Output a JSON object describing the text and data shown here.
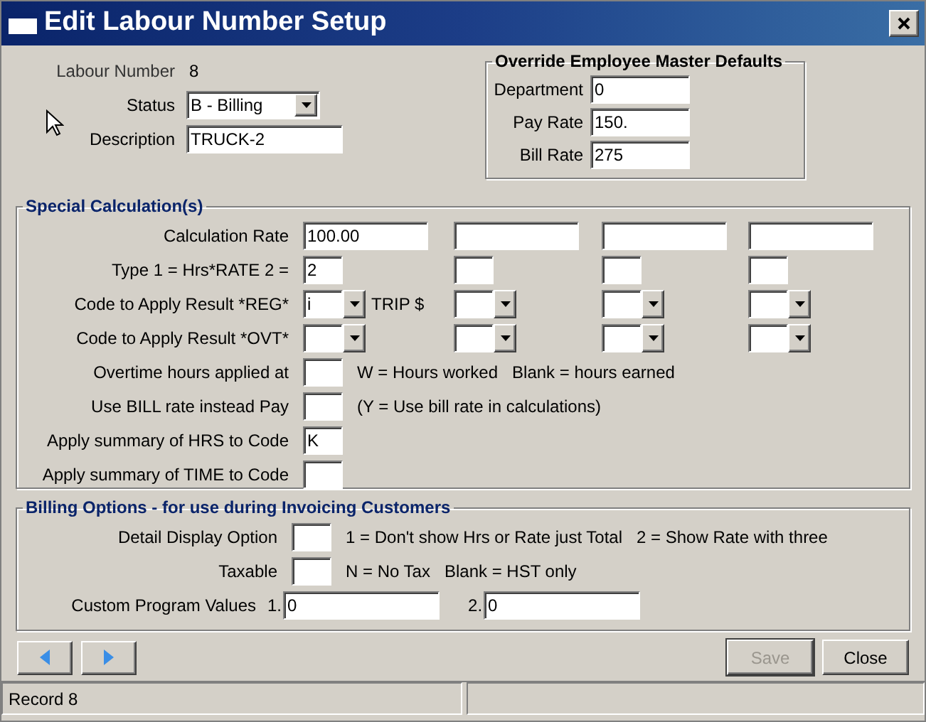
{
  "window": {
    "title": "Edit Labour Number Setup"
  },
  "header": {
    "labour_number": {
      "label": "Labour Number",
      "value": "8"
    },
    "status": {
      "label": "Status",
      "value": "B - Billing"
    },
    "description": {
      "label": "Description",
      "value": "TRUCK-2"
    }
  },
  "override": {
    "title": "Override Employee Master Defaults",
    "fields": [
      {
        "label": "Department",
        "value": "0"
      },
      {
        "label": "Pay Rate",
        "value": "150."
      },
      {
        "label": "Bill Rate",
        "value": "275"
      }
    ]
  },
  "special": {
    "title": "Special Calculation(s)",
    "rows": [
      {
        "label": "Calculation Rate",
        "cells": [
          {
            "kind": "wide",
            "value": "100.00"
          },
          {
            "kind": "wide"
          },
          {
            "kind": "wide"
          },
          {
            "kind": "wide"
          }
        ]
      },
      {
        "label": "Type 1 = Hrs*RATE  2 =",
        "cells": [
          {
            "kind": "narrow",
            "value": "2"
          },
          {
            "kind": "narrow"
          },
          {
            "kind": "narrow"
          },
          {
            "kind": "narrow"
          }
        ]
      },
      {
        "label": "Code to Apply Result *REG*",
        "cells": [
          {
            "kind": "combo",
            "value": "i",
            "note": "TRIP $"
          },
          {
            "kind": "combo"
          },
          {
            "kind": "combo"
          },
          {
            "kind": "combo"
          }
        ]
      },
      {
        "label": "Code to Apply Result *OVT*",
        "cells": [
          {
            "kind": "combo"
          },
          {
            "kind": "combo"
          },
          {
            "kind": "combo"
          },
          {
            "kind": "combo"
          }
        ]
      },
      {
        "label": "Overtime hours applied at",
        "cells": [
          {
            "kind": "narrow"
          }
        ],
        "notes": [
          "W = Hours worked",
          "Blank = hours earned"
        ]
      },
      {
        "label": "Use BILL rate instead Pay",
        "cells": [
          {
            "kind": "narrow"
          }
        ],
        "notes": [
          "(Y = Use bill rate in calculations)"
        ]
      },
      {
        "label": "Apply summary of HRS to Code",
        "cells": [
          {
            "kind": "narrow",
            "value": "K"
          }
        ]
      },
      {
        "label": "Apply summary of TIME to Code",
        "cells": [
          {
            "kind": "narrow"
          }
        ]
      }
    ]
  },
  "billing": {
    "title": "Billing Options - for use during Invoicing Customers",
    "rows": [
      {
        "label": "Detail Display Option",
        "notes": [
          "1 = Don't show Hrs or Rate just Total",
          "2 = Show Rate with three"
        ]
      },
      {
        "label": "Taxable",
        "notes": [
          "N = No Tax",
          "Blank = HST only"
        ]
      }
    ],
    "custom": {
      "label": "Custom Program Values",
      "fields": [
        {
          "prefix": "1.",
          "value": "0"
        },
        {
          "prefix": "2.",
          "value": "0"
        }
      ]
    }
  },
  "buttons": [
    {
      "label": "Save",
      "disabled": true
    },
    {
      "label": "Close",
      "disabled": false
    }
  ],
  "status_bar": {
    "record": "Record 8"
  }
}
